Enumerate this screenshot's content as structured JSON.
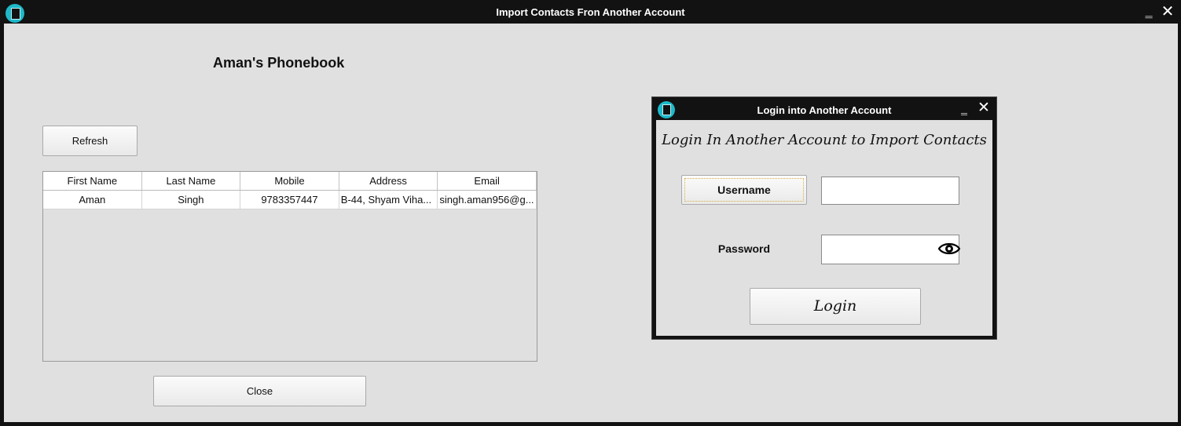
{
  "window": {
    "title": "Import Contacts Fron Another Account",
    "minimize_glyph": "‗",
    "close_glyph": "✕"
  },
  "main": {
    "heading": "Aman's Phonebook",
    "refresh_label": "Refresh",
    "close_label": "Close",
    "table": {
      "columns": [
        "First Name",
        "Last Name",
        "Mobile",
        "Address",
        "Email"
      ],
      "rows": [
        [
          "Aman",
          "Singh",
          "9783357447",
          "B-44, Shyam  Viha...",
          "singh.aman956@g..."
        ]
      ]
    }
  },
  "dialog": {
    "title": "Login into Another Account",
    "minimize_glyph": "‗",
    "close_glyph": "✕",
    "heading": "Login In Another Account to Import Contacts",
    "username_label": "Username",
    "username_value": "",
    "password_label": "Password",
    "password_value": "",
    "login_label": "Login",
    "eye_icon": "eye-icon"
  },
  "colors": {
    "titlebar": "#121212",
    "background": "#e0e0e0",
    "app_icon": "#1eb9c9",
    "focus_border": "#d8b04a"
  }
}
